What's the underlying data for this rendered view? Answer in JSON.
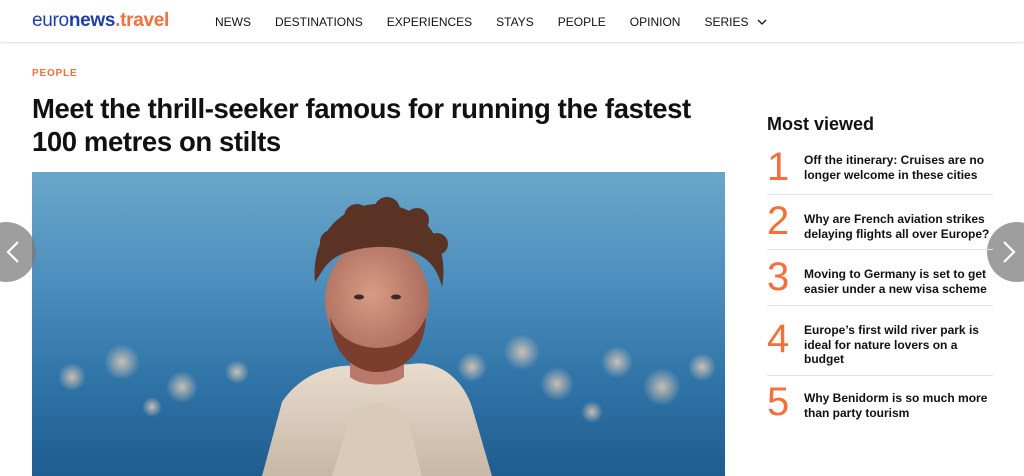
{
  "header": {
    "logo": {
      "part1": "euro",
      "part2": "news",
      "part3": ".travel"
    },
    "nav": [
      "NEWS",
      "DESTINATIONS",
      "EXPERIENCES",
      "STAYS",
      "PEOPLE",
      "OPINION",
      "SERIES"
    ]
  },
  "article": {
    "category": "PEOPLE",
    "title": "Meet the thrill-seeker famous for running the fastest 100 metres on stilts"
  },
  "most_viewed": {
    "title": "Most viewed",
    "items": [
      {
        "rank": "1",
        "title": "Off the itinerary: Cruises are no longer welcome in these cities"
      },
      {
        "rank": "2",
        "title": "Why are French aviation strikes delaying flights all over Europe?"
      },
      {
        "rank": "3",
        "title": "Moving to Germany is set to get easier under a new visa scheme"
      },
      {
        "rank": "4",
        "title": "Europe’s first wild river park is ideal for nature lovers on a budget"
      },
      {
        "rank": "5",
        "title": "Why Benidorm is so much more than party tourism"
      }
    ]
  },
  "icons": {
    "series_dropdown": "chevron-down-icon",
    "carousel_prev": "chevron-left-icon",
    "carousel_next": "chevron-right-icon"
  },
  "colors": {
    "accent": "#f36f3b",
    "brand_blue": "#1f3ea8"
  }
}
